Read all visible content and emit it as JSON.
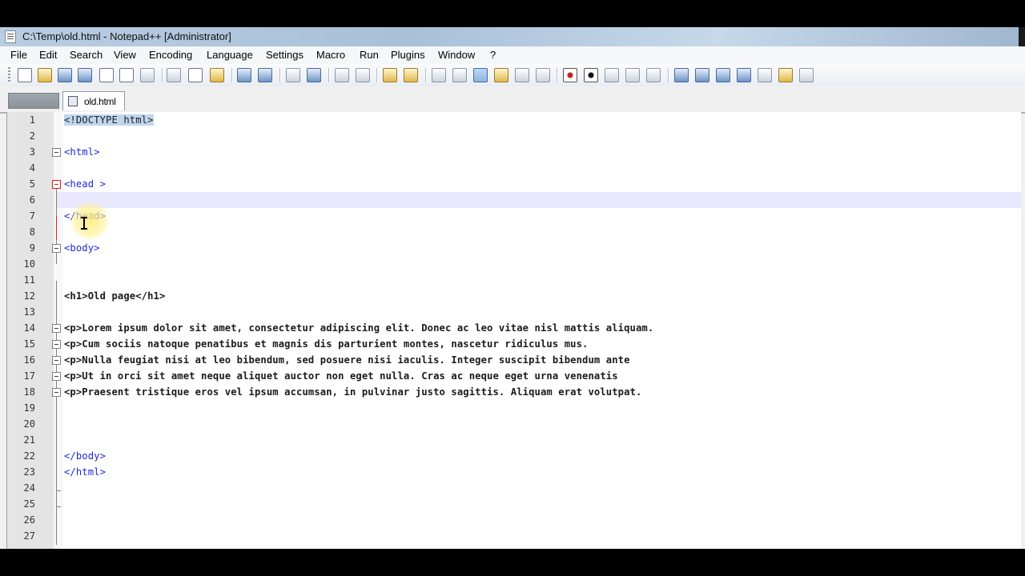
{
  "window": {
    "title": "C:\\Temp\\old.html - Notepad++ [Administrator]"
  },
  "menu": [
    "File",
    "Edit",
    "Search",
    "View",
    "Encoding",
    "Language",
    "Settings",
    "Macro",
    "Run",
    "Plugins",
    "Window",
    "?"
  ],
  "tabs": [
    {
      "label": "",
      "active": false
    },
    {
      "label": "old.html",
      "active": true
    }
  ],
  "editor": {
    "current_line": 6,
    "lines": [
      {
        "n": "1",
        "text": "<!DOCTYPE html>"
      },
      {
        "n": "2",
        "text": ""
      },
      {
        "n": "3",
        "text": "<html>"
      },
      {
        "n": "4",
        "text": ""
      },
      {
        "n": "5",
        "text": "<head >"
      },
      {
        "n": "6",
        "text": ""
      },
      {
        "n": "7",
        "text": "</head>"
      },
      {
        "n": "8",
        "text": ""
      },
      {
        "n": "9",
        "text": "<body>"
      },
      {
        "n": "10",
        "text": ""
      },
      {
        "n": "11",
        "text": ""
      },
      {
        "n": "12",
        "text": "<h1>Old page</h1>"
      },
      {
        "n": "13",
        "text": ""
      },
      {
        "n": "14",
        "text": "<p>Lorem ipsum dolor sit amet, consectetur adipiscing elit. Donec ac leo vitae nisl mattis aliquam."
      },
      {
        "n": "15",
        "text": "<p>Cum sociis natoque penatibus et magnis dis parturient montes, nascetur ridiculus mus."
      },
      {
        "n": "16",
        "text": "<p>Nulla feugiat nisi at leo bibendum, sed posuere nisi iaculis. Integer suscipit bibendum ante"
      },
      {
        "n": "17",
        "text": "<p>Ut in orci sit amet neque aliquet auctor non eget nulla. Cras ac neque eget urna venenatis"
      },
      {
        "n": "18",
        "text": "<p>Praesent tristique eros vel ipsum accumsan, in pulvinar justo sagittis. Aliquam erat volutpat."
      },
      {
        "n": "19",
        "text": ""
      },
      {
        "n": "20",
        "text": ""
      },
      {
        "n": "21",
        "text": ""
      },
      {
        "n": "22",
        "text": "</body>"
      },
      {
        "n": "23",
        "text": "</html>"
      },
      {
        "n": "24",
        "text": ""
      },
      {
        "n": "25",
        "text": ""
      },
      {
        "n": "26",
        "text": ""
      },
      {
        "n": "27",
        "text": ""
      }
    ]
  }
}
